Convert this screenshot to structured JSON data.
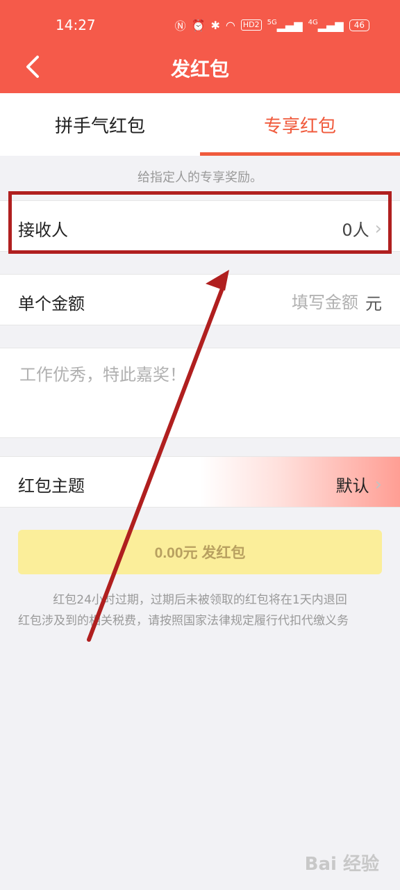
{
  "status_bar": {
    "time": "14:27",
    "icons": [
      "nfc-icon",
      "alarm-icon",
      "bluetooth-icon",
      "wifi-icon",
      "hd-icon",
      "5g-signal-icon",
      "4g-signal-icon",
      "battery-icon"
    ],
    "hd_label": "HD2",
    "net1_label": "5G",
    "net2_label": "4G",
    "battery_level": "46"
  },
  "header": {
    "title": "发红包"
  },
  "tabs": [
    {
      "label": "拼手气红包",
      "active": false
    },
    {
      "label": "专享红包",
      "active": true
    }
  ],
  "hint": "给指定人的专享奖励。",
  "receiver": {
    "label": "接收人",
    "value": "0人"
  },
  "amount": {
    "label": "单个金额",
    "placeholder": "填写金额",
    "unit": "元"
  },
  "message": {
    "placeholder": "工作优秀，特此嘉奖！"
  },
  "theme": {
    "label": "红包主题",
    "value": "默认"
  },
  "send_button": {
    "label": "0.00元 发红包"
  },
  "notice": {
    "line1": "红包24小时过期，过期后未被领取的红包将在1天内退回",
    "line2": "红包涉及到的相关税费，请按照国家法律规定履行代扣代缴义务"
  },
  "watermark": "Bai 经验",
  "colors": {
    "header_bg": "#f55a4a",
    "accent": "#f05a3c",
    "send_button_bg": "#fbee9a",
    "annotation": "#b01f1f"
  }
}
